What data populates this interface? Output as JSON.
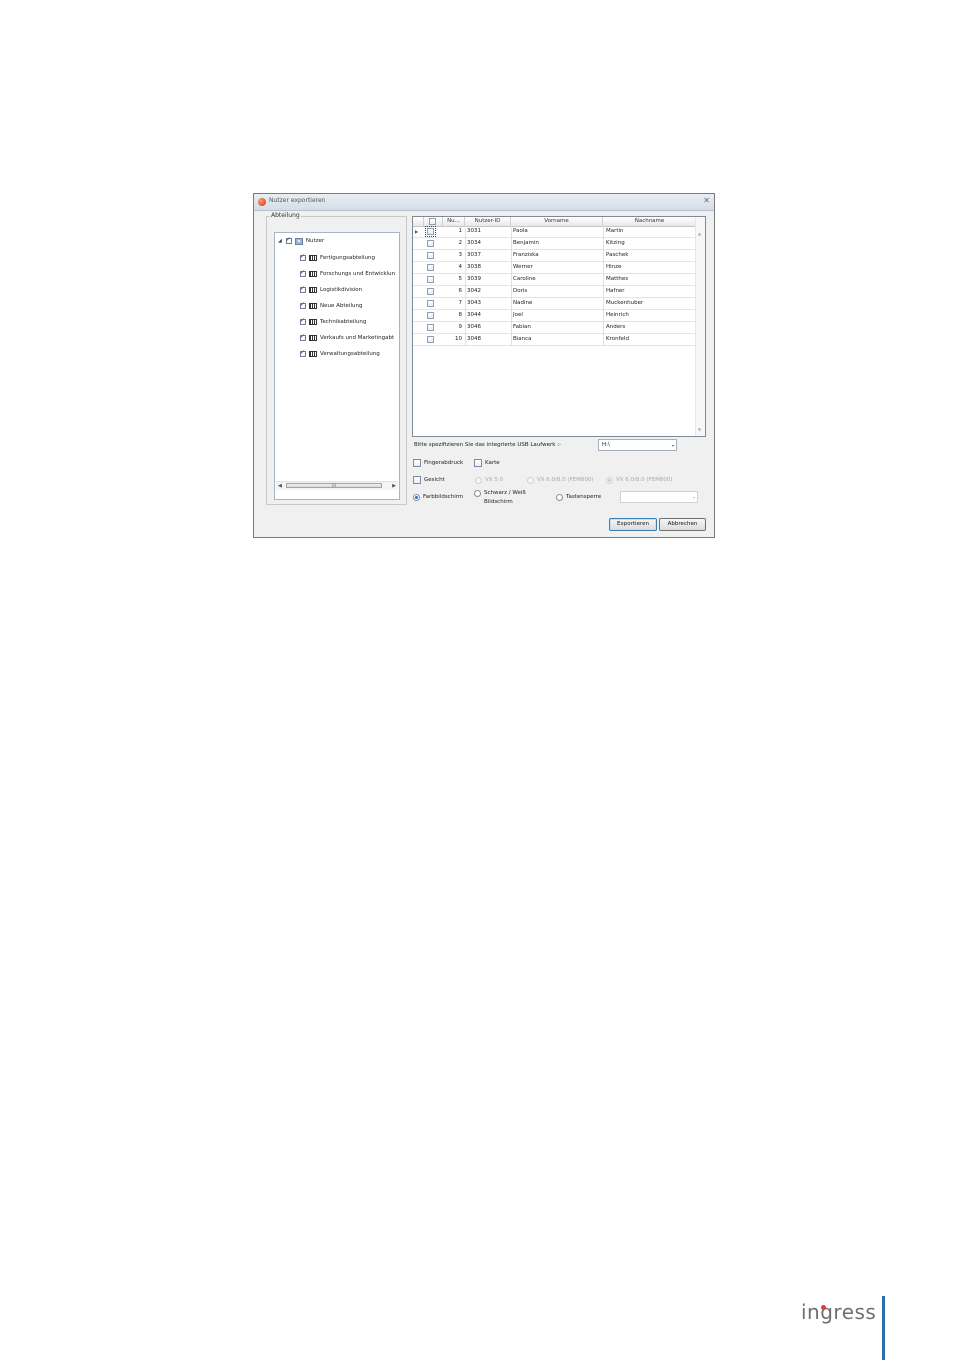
{
  "window": {
    "title": "Nutzer exportieren",
    "close_glyph": "✕"
  },
  "department_panel": {
    "legend": "Abteilung",
    "root": {
      "label": "Nutzer",
      "checked": true,
      "expand_glyph": "◢"
    },
    "items": [
      {
        "label": "Fertigungsabteilung",
        "checked": true
      },
      {
        "label": "Forschungs und Entwicklun",
        "checked": true
      },
      {
        "label": "Logistikdivision",
        "checked": true
      },
      {
        "label": "Neue Abteilung",
        "checked": true
      },
      {
        "label": "Technikabteilung",
        "checked": true
      },
      {
        "label": "Verkaufs und Marketingabt",
        "checked": true
      },
      {
        "label": "Verwaltungsabteilung",
        "checked": true
      }
    ],
    "scroll_thumb_glyph": "III",
    "scroll_left_glyph": "◀",
    "scroll_right_glyph": "▶"
  },
  "user_grid": {
    "columns": [
      "Nu...",
      "Nutzer-ID",
      "Vorname",
      "Nachname"
    ],
    "row_pointer_glyph": "▶",
    "rows": [
      {
        "no": "1",
        "id": "3031",
        "first": "Paola",
        "last": "Martin"
      },
      {
        "no": "2",
        "id": "3034",
        "first": "Benjamin",
        "last": "Kitzing"
      },
      {
        "no": "3",
        "id": "3037",
        "first": "Franziska",
        "last": "Paschek"
      },
      {
        "no": "4",
        "id": "3038",
        "first": "Werner",
        "last": "Hinze"
      },
      {
        "no": "5",
        "id": "3039",
        "first": "Caroline",
        "last": "Matthes"
      },
      {
        "no": "6",
        "id": "3042",
        "first": "Doris",
        "last": "Hafner"
      },
      {
        "no": "7",
        "id": "3043",
        "first": "Nadine",
        "last": "Muckenhuber"
      },
      {
        "no": "8",
        "id": "3044",
        "first": "Joel",
        "last": "Heinrich"
      },
      {
        "no": "9",
        "id": "3046",
        "first": "Fabian",
        "last": "Anders"
      },
      {
        "no": "10",
        "id": "3048",
        "first": "Bianca",
        "last": "Kronfeld"
      }
    ]
  },
  "options": {
    "usb_label": "Bitte spezifizieren Sie das integrierte USB Laufwerk :-",
    "usb_value": "H:\\",
    "combo_arrow": "▾",
    "fingerprint": "Fingerabdruck",
    "card": "Karte",
    "face": "Gesicht",
    "face_vx5": "VX 5.0",
    "face_vx6_800": "VX 6.0/8.0 (FEM800)",
    "face_vx6_800b": "VX 6.0/8.0 (FEM800)",
    "color_screen": "Farbbildschirm",
    "bw_screen_line1": "Schwarz / Weiß",
    "bw_screen_line2": "Bildschirm",
    "keylock": "Tastensperre"
  },
  "buttons": {
    "export": "Exportieren",
    "cancel": "Abbrechen"
  },
  "brand": {
    "name": "ingress"
  }
}
